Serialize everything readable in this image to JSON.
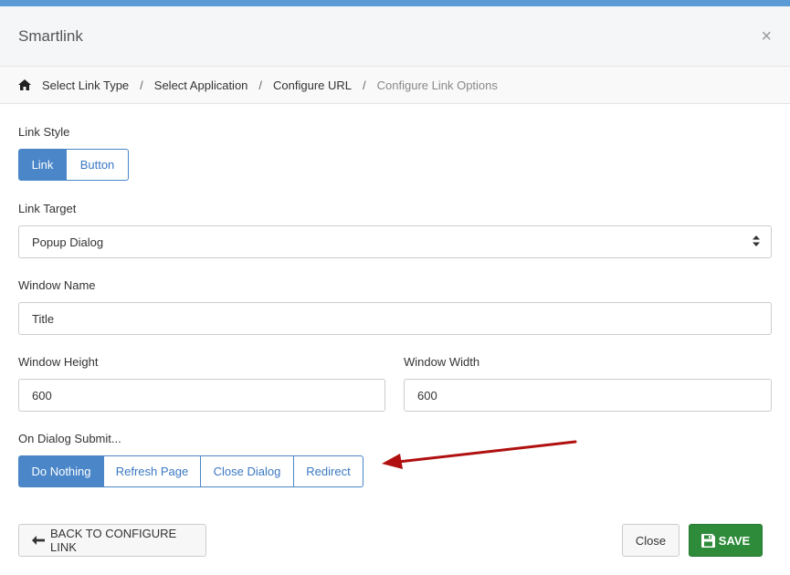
{
  "dialog": {
    "title": "Smartlink",
    "close_glyph": "×"
  },
  "breadcrumb": {
    "items": [
      "Select Link Type",
      "Select Application",
      "Configure URL"
    ],
    "current": "Configure Link Options",
    "separator": "/"
  },
  "form": {
    "link_style": {
      "label": "Link Style",
      "options": [
        "Link",
        "Button"
      ],
      "selected": "Link"
    },
    "link_target": {
      "label": "Link Target",
      "value": "Popup Dialog"
    },
    "window_name": {
      "label": "Window Name",
      "value": "Title"
    },
    "window_height": {
      "label": "Window Height",
      "value": "600"
    },
    "window_width": {
      "label": "Window Width",
      "value": "600"
    },
    "on_submit": {
      "label": "On Dialog Submit...",
      "options": [
        "Do Nothing",
        "Refresh Page",
        "Close Dialog",
        "Redirect"
      ],
      "selected": "Do Nothing"
    }
  },
  "footer": {
    "back_label": "BACK TO CONFIGURE LINK",
    "close_label": "Close",
    "save_label": "SAVE"
  },
  "colors": {
    "accent": "#4a86c8",
    "save": "#2e8b3a",
    "arrow": "#b01010"
  }
}
